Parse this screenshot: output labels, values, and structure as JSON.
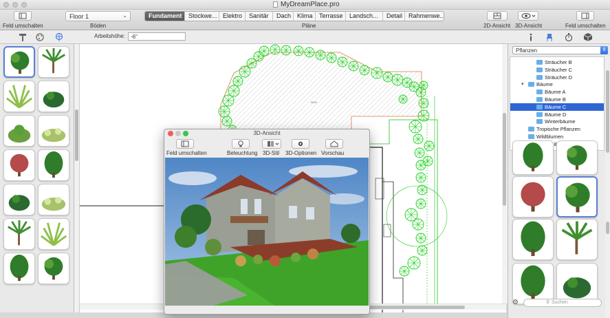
{
  "window": {
    "title": "MyDreamPlace.pro"
  },
  "toolbar": {
    "toggle_left_label": "Feld umschalten",
    "floors_label": "Böden",
    "floor_value": "Floor 1",
    "plans_label": "Pläne",
    "plan_tabs": [
      "Fundament",
      "Stockwe...",
      "Elektro",
      "Sanitär",
      "Dach",
      "Klima",
      "Terrasse",
      "Landsch...",
      "Detail",
      "Rahmenwe..."
    ],
    "active_tab_index": 0,
    "view2d_label": "2D-Ansicht",
    "view3d_label": "3D-Ansicht",
    "toggle_right_label": "Feld umschalten"
  },
  "subbar": {
    "height_label": "Arbeitshöhe:",
    "height_value": "-6\""
  },
  "canvas": {
    "area_label": "6826"
  },
  "window3d": {
    "title": "3D-Ansicht",
    "buttons": [
      "Feld umschalten",
      "Beleuchtung",
      "3D-Stil",
      "3D-Optionen",
      "Vorschau"
    ]
  },
  "right_panel": {
    "category_dropdown": "Pflanzen",
    "tree": [
      {
        "label": "Sträucher B",
        "level": 2,
        "selected": false
      },
      {
        "label": "Sträucher C",
        "level": 2,
        "selected": false
      },
      {
        "label": "Sträucher D",
        "level": 2,
        "selected": false
      },
      {
        "label": "Bäume",
        "level": 1,
        "selected": false,
        "expanded": true
      },
      {
        "label": "Bäume A",
        "level": 2,
        "selected": false
      },
      {
        "label": "Bäume B",
        "level": 2,
        "selected": false
      },
      {
        "label": "Bäume C",
        "level": 2,
        "selected": true
      },
      {
        "label": "Bäume D",
        "level": 2,
        "selected": false
      },
      {
        "label": "Winterbäume",
        "level": 2,
        "selected": false
      },
      {
        "label": "Tropische Pflanzen",
        "level": 1,
        "selected": false
      },
      {
        "label": "Wildblumen",
        "level": 1,
        "selected": false
      },
      {
        "label": "Benutzer-Bibliothek",
        "level": 0,
        "selected": false,
        "expanded": false
      }
    ],
    "search_placeholder": "Suchen"
  },
  "colors": {
    "selection": "#3066d4",
    "tile_selected_border": "#5b7fd4",
    "plant_symbol": "#1fd21f",
    "active_tab": "#5f5f5f"
  },
  "icons": {
    "left_palette_tools": [
      "hammer-icon",
      "palette-icon",
      "plant-icon"
    ],
    "right_palette_tools": [
      "info-icon",
      "chair-icon",
      "timer-icon",
      "box-icon"
    ]
  }
}
